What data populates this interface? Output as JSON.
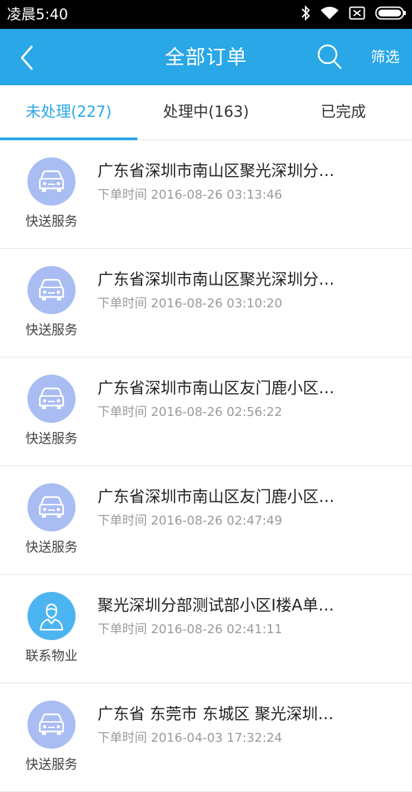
{
  "status_bar": {
    "time": "凌晨5:40"
  },
  "header": {
    "title": "全部订单",
    "filter_label": "筛选"
  },
  "tabs": [
    {
      "label": "未处理(227)"
    },
    {
      "label": "处理中(163)"
    },
    {
      "label": "已完成"
    }
  ],
  "orders": [
    {
      "service": "快送服务",
      "icon": "car-icon",
      "address": "广东省深圳市南山区聚光深圳分…",
      "time": "下单时间 2016-08-26 03:13:46"
    },
    {
      "service": "快送服务",
      "icon": "car-icon",
      "address": "广东省深圳市南山区聚光深圳分…",
      "time": "下单时间 2016-08-26 03:10:20"
    },
    {
      "service": "快送服务",
      "icon": "car-icon",
      "address": "广东省深圳市南山区友门鹿小区…",
      "time": "下单时间 2016-08-26 02:56:22"
    },
    {
      "service": "快送服务",
      "icon": "car-icon",
      "address": "广东省深圳市南山区友门鹿小区…",
      "time": "下单时间 2016-08-26 02:47:49"
    },
    {
      "service": "联系物业",
      "icon": "person-icon",
      "address": "聚光深圳分部测试部小区I楼A单…",
      "time": "下单时间 2016-08-26 02:41:11"
    },
    {
      "service": "快送服务",
      "icon": "car-icon",
      "address": "广东省 东莞市 东城区 聚光深圳…",
      "time": "下单时间 2016-04-03 17:32:24"
    }
  ],
  "colors": {
    "primary": "#29a7e6",
    "car_avatar": "#a9bdf3",
    "person_avatar": "#4cb4f0"
  }
}
